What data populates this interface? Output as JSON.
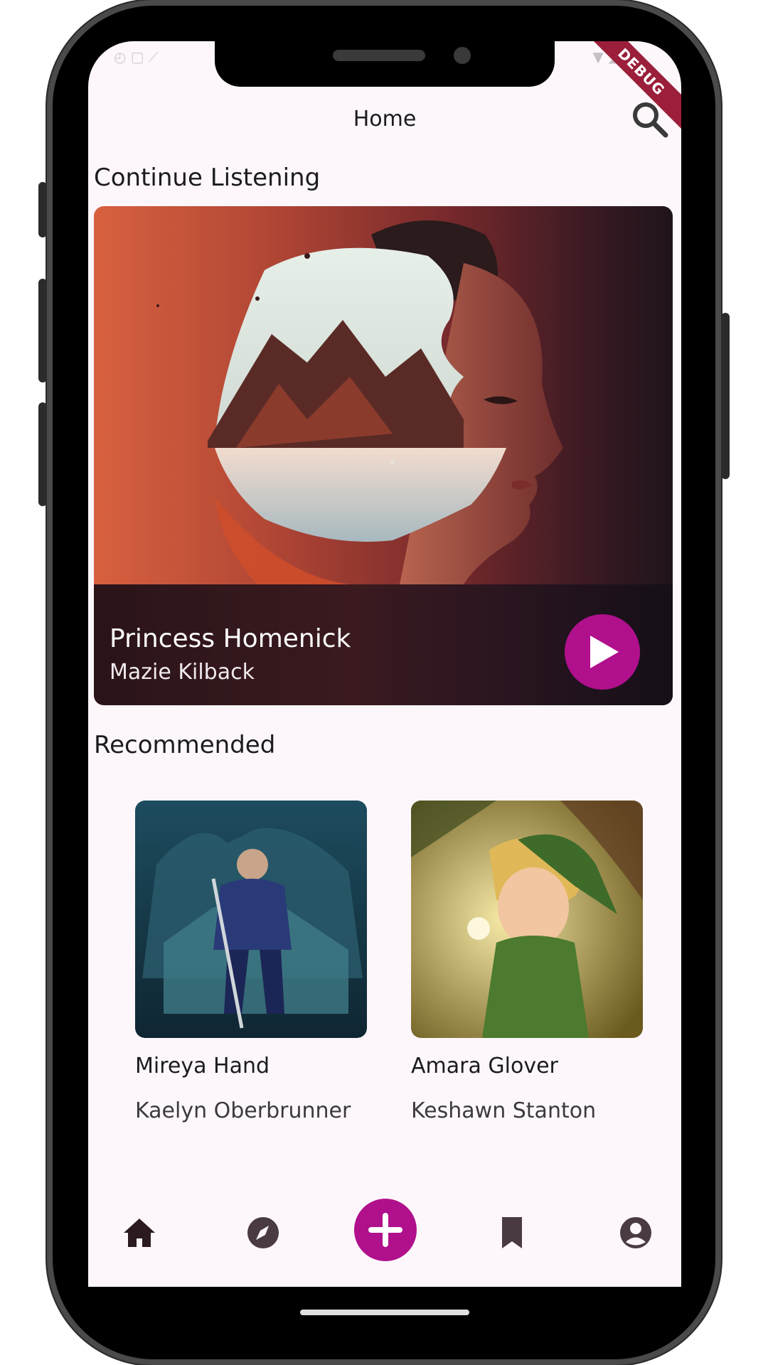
{
  "app": {
    "title": "Home"
  },
  "status_bar": {
    "debug_banner": "DEBUG"
  },
  "continue_listening": {
    "heading": "Continue Listening",
    "item": {
      "title": "Princess Homenick",
      "author": "Mazie Kilback"
    }
  },
  "recommended": {
    "heading": "Recommended",
    "items": [
      {
        "title": "Mireya Hand",
        "author": "Kaelyn Oberbrunner"
      },
      {
        "title": "Amara Glover",
        "author": "Keshawn Stanton"
      }
    ]
  },
  "bottom_nav": {
    "items": [
      {
        "icon": "home-icon",
        "active": true
      },
      {
        "icon": "compass-icon"
      },
      {
        "icon": "add-icon"
      },
      {
        "icon": "bookmark-icon"
      },
      {
        "icon": "account-icon"
      }
    ]
  },
  "colors": {
    "accent": "#b0108c",
    "background": "#fdf7fc",
    "text": "#1c1b1f"
  }
}
